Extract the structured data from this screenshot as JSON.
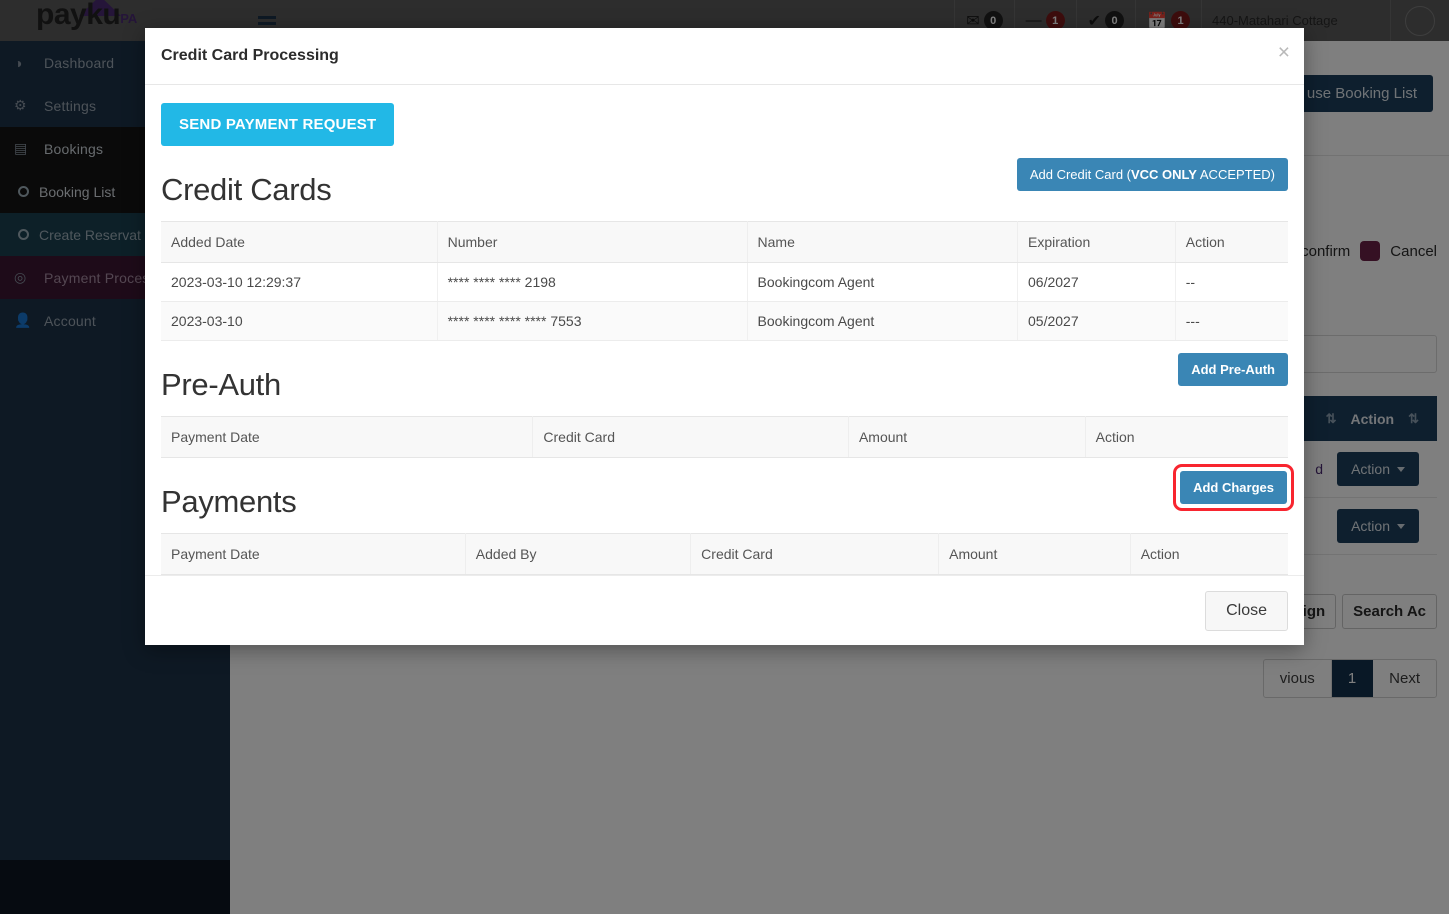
{
  "brand": {
    "logo_text": "payku",
    "logo_suffix": "PA",
    "accent_purple": "#4b2a73",
    "sidebar_bg": "#1d3349",
    "topbar_bg": "#5b5b5b"
  },
  "sidebar": {
    "items": [
      {
        "label": "Dashboard",
        "icon": "dashboard-icon",
        "glyph": "◔"
      },
      {
        "label": "Settings",
        "icon": "gear-icon",
        "glyph": "⚙"
      },
      {
        "label": "Bookings",
        "icon": "bookings-icon",
        "glyph": "▤"
      }
    ],
    "sub_items": [
      {
        "label": "Booking List",
        "icon": "circle-icon",
        "selected": true
      },
      {
        "label": "Create Reservat",
        "icon": "circle-icon",
        "selected": false
      }
    ],
    "payment_item": {
      "label": "Payment Process",
      "icon": "target-icon",
      "glyph": "◎"
    },
    "account_item": {
      "label": "Account",
      "icon": "user-icon",
      "glyph": "♟"
    }
  },
  "topbar": {
    "menu_icon": "hamburger-icon",
    "badges": [
      {
        "icon": "envelope-open-icon",
        "glyph": "✉",
        "count": "0",
        "style": "dark"
      },
      {
        "icon": "minus-icon",
        "glyph": "➖",
        "count": "1",
        "style": "red"
      },
      {
        "icon": "check-icon",
        "glyph": "✔",
        "count": "0",
        "style": "dark"
      },
      {
        "icon": "calendar-icon",
        "glyph": "Ὄ5",
        "count": "1",
        "style": "red"
      }
    ],
    "property_select": {
      "value": "440-Matahari Cottage",
      "caret_icon": "chevron-down-icon"
    },
    "user_caret_icon": "chevron-down-icon"
  },
  "page": {
    "howto_button": "w to use Booking List",
    "legend": {
      "confirm_label": "confirm",
      "cancel_label": "Cancel",
      "cancel_color": "#6b2146"
    },
    "search_placeholder": "",
    "grid_header_action": "Action",
    "sort_icon": "sort-icon",
    "rows": [
      {
        "text": "d",
        "action_label": "Action"
      },
      {
        "text": "",
        "action_label": "Action"
      }
    ],
    "bulk_buttons": [
      "ssign ",
      "Search Ac"
    ],
    "pagination": {
      "previous": "vious",
      "current": "1",
      "next": "Next"
    }
  },
  "modal": {
    "title": "Credit Card Processing",
    "close_icon": "close-icon",
    "send_payment_request": "SEND PAYMENT REQUEST",
    "credit_cards": {
      "title": "Credit Cards",
      "add_button_prefix": "Add Credit Card (",
      "add_button_bold": "VCC ONLY",
      "add_button_suffix": " ACCEPTED)",
      "columns": [
        "Added Date",
        "Number",
        "Name",
        "Expiration",
        "Action"
      ],
      "rows": [
        {
          "added_date": "2023-03-10 12:29:37",
          "number": "**** **** **** 2198",
          "name": "Bookingcom Agent",
          "expiration": "06/2027",
          "action": "--"
        },
        {
          "added_date": "2023-03-10",
          "number": "**** **** **** **** 7553",
          "name": "Bookingcom Agent",
          "expiration": "05/2027",
          "action": "---"
        }
      ]
    },
    "pre_auth": {
      "title": "Pre-Auth",
      "add_button": "Add Pre-Auth",
      "columns": [
        "Payment Date",
        "Credit Card",
        "Amount",
        "Action"
      ],
      "rows": []
    },
    "payments": {
      "title": "Payments",
      "add_button": "Add Charges",
      "add_button_highlighted": true,
      "highlight_color": "#f8252f",
      "columns": [
        "Payment Date",
        "Added By",
        "Credit Card",
        "Amount",
        "Action"
      ],
      "rows": []
    },
    "close_button": "Close"
  }
}
